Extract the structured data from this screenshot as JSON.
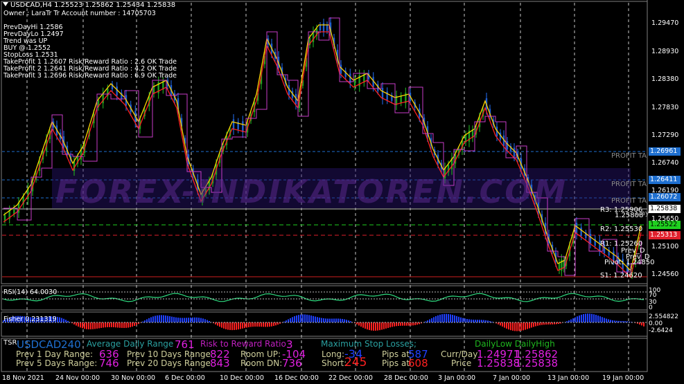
{
  "window": {
    "symbol_line": "USDCAD,H4  1.25523 1.25862 1.25434 1.25838"
  },
  "info_lines": [
    "Owner : LaraTr Tr Account number : 14705703",
    "PrevDayHi 1.2586",
    "PrevDayLo 1.2497",
    "Trend was UP",
    "BUY @ 1.2552",
    "StopLoss 1.2531",
    "TakeProfit 1 1.2607 Risk/Reward Ratio : 2.6 OK Trade",
    "TakeProfit 2 1.2641 Risk/Reward Ratio : 4.2 OK Trade",
    "TakeProfit 3 1.2696 Risk/Reward Ratio : 6.9 OK Trade"
  ],
  "price_axis": [
    "1.29470",
    "1.28930",
    "1.28380",
    "1.27830",
    "1.27290",
    "1.26740",
    "1.26190",
    "1.25650",
    "1.25100",
    "1.24560"
  ],
  "badges": [
    {
      "text": "1.26961",
      "bg": "#1e6fd0",
      "fg": "#ffffff"
    },
    {
      "text": "1.26411",
      "bg": "#1e6fd0",
      "fg": "#ffffff"
    },
    {
      "text": "1.26072",
      "bg": "#1e6fd0",
      "fg": "#ffffff"
    },
    {
      "text": "1.25838",
      "bg": "#ffffff",
      "fg": "#000000"
    },
    {
      "text": "1.25522",
      "bg": "#1fd01f",
      "fg": "#000000"
    },
    {
      "text": "1.25313",
      "bg": "#e0202c",
      "fg": "#ffffff"
    }
  ],
  "watermark": "FOREX-INDIKATOREN.COM",
  "profit_labels": [
    "PROFIT TA",
    "PROFIT TA",
    "PROFIT TA"
  ],
  "pivot_labels": [
    "R3: 1.25906",
    "1.25808",
    "R2: 1.25530",
    "R1: 1.25260",
    "Prev_D",
    "Prev_D",
    "Pivot: 1.24850",
    "S1: 1.24620"
  ],
  "pivot_extra": [
    "Day"
  ],
  "rsi": {
    "label": "RSI(14) 64.0030",
    "levels": [
      "100",
      "70",
      "30",
      "0"
    ]
  },
  "fisher": {
    "label": "Fisher 0.231319",
    "levels": [
      "2.554822",
      "0.00",
      "-2.6424"
    ]
  },
  "tsr": {
    "title": "TSR",
    "symbol": "USDCAD",
    "tf": "240",
    "adr_label": "Average Daily Range",
    "adr_value": "761",
    "rr_label": "Risk to Reward Ratio",
    "rr_value": "3",
    "msl_label": "Maximum Stop Losses;",
    "dlh_label": "DailyLow DailyHigh",
    "row1": {
      "l1": "Prev 1 Day Range:",
      "v1": "636",
      "l2": "Prev 10 Days Range",
      "v2": "822",
      "l3": "Room UP:",
      "v3": "-104",
      "l4": "Long:",
      "v4": "-34",
      "l5": "Pips at",
      "v5": "587",
      "l6": "Curr/Day",
      "v6a": "1.24971",
      "v6b": "1.25862"
    },
    "row2": {
      "l1": "Prev 5 Days Range:",
      "v1": "746",
      "l2": "Prev 20 Days Range",
      "v2": "843",
      "l3": "Room DN:",
      "v3": "736",
      "l4": "Short:",
      "v4": "245",
      "l5": "Pips at",
      "v5": "608",
      "l6": "Price",
      "v6a": "1.25838",
      "v6b": "1.25838"
    }
  },
  "dates": [
    "18 Nov 2021",
    "24 Nov 00:00",
    "30 Nov 00:00",
    "6 Dec 00:00",
    "10 Dec 00:00",
    "16 Dec 00:00",
    "22 Dec 00:00",
    "28 Dec 00:00",
    "3 Jan 00:00",
    "7 Jan 00:00",
    "13 Jan 00:00",
    "19 Jan 00:00"
  ],
  "colors": {
    "bull": "#1fa31f",
    "bear": "#1e5fd0",
    "grid": "#ffffff",
    "rsi": "#2fdc80",
    "fisher_pos": "#2040ff",
    "fisher_neg": "#ff2020",
    "magenta": "#c83cc8",
    "red": "#ff2020",
    "yellow": "#ffd200"
  },
  "icons": [
    "dropdown-triangle-icon"
  ]
}
